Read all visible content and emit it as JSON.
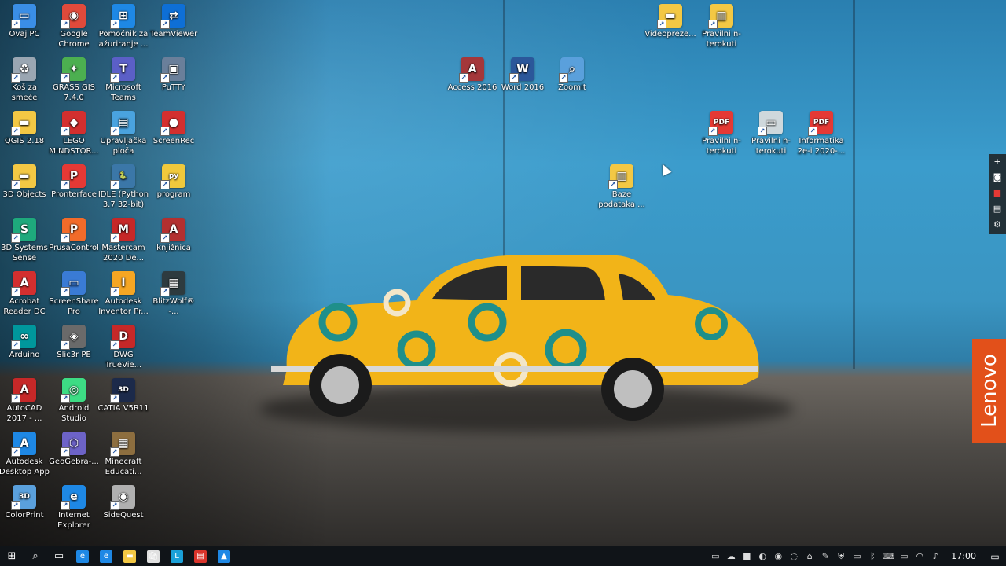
{
  "desktop": {
    "icons": [
      {
        "label": "Ovaj PC",
        "icon": "computer-icon",
        "color": "#3a8ee6",
        "glyph": "▭"
      },
      {
        "label": "Google Chrome",
        "icon": "chrome-icon",
        "color": "#e04a3b",
        "glyph": "◉"
      },
      {
        "label": "Pomoćnik za ažuriranje ...",
        "icon": "windows-update-icon",
        "color": "#1e88e5",
        "glyph": "⊞"
      },
      {
        "label": "TeamViewer",
        "icon": "teamviewer-icon",
        "color": "#0e6fd6",
        "glyph": "⇄"
      },
      {
        "label": "Koš za smeće",
        "icon": "recycle-bin-icon",
        "color": "#9aa6b2",
        "glyph": "♻"
      },
      {
        "label": "GRASS GIS 7.4.0",
        "icon": "grass-gis-icon",
        "color": "#4caf50",
        "glyph": "✦"
      },
      {
        "label": "Microsoft Teams",
        "icon": "teams-icon",
        "color": "#5b5fc7",
        "glyph": "T"
      },
      {
        "label": "PuTTY",
        "icon": "putty-icon",
        "color": "#6a7f9a",
        "glyph": "▣"
      },
      {
        "label": "QGIS 2.18",
        "icon": "qgis-folder-icon",
        "color": "#f3c844",
        "glyph": "▬"
      },
      {
        "label": "LEGO MINDSTOR...",
        "icon": "lego-mindstorms-icon",
        "color": "#d32f2f",
        "glyph": "◆"
      },
      {
        "label": "Upravljačka ploča",
        "icon": "control-panel-icon",
        "color": "#4aa3df",
        "glyph": "▤"
      },
      {
        "label": "ScreenRec",
        "icon": "screenrec-icon",
        "color": "#d32f2f",
        "glyph": "●"
      },
      {
        "label": "3D Objects",
        "icon": "3d-objects-folder-icon",
        "color": "#f3c844",
        "glyph": "▬"
      },
      {
        "label": "Pronterface",
        "icon": "pronterface-icon",
        "color": "#e53935",
        "glyph": "P"
      },
      {
        "label": "IDLE (Python 3.7 32-bit)",
        "icon": "python-idle-icon",
        "color": "#3b77a8",
        "glyph": "🐍"
      },
      {
        "label": "program",
        "icon": "python-file-icon",
        "color": "#f0c93c",
        "glyph": "py"
      },
      {
        "label": "3D Systems Sense",
        "icon": "3d-systems-sense-icon",
        "color": "#1ea97c",
        "glyph": "S"
      },
      {
        "label": "PrusaControl",
        "icon": "prusacontrol-icon",
        "color": "#f26b2a",
        "glyph": "P"
      },
      {
        "label": "Mastercam 2020 De...",
        "icon": "mastercam-icon",
        "color": "#c62828",
        "glyph": "M"
      },
      {
        "label": "knjižnica",
        "icon": "access-file-icon",
        "color": "#b33030",
        "glyph": "A"
      },
      {
        "label": "Acrobat Reader DC",
        "icon": "acrobat-icon",
        "color": "#d32f2f",
        "glyph": "A"
      },
      {
        "label": "ScreenShare Pro",
        "icon": "screenshare-icon",
        "color": "#3a7bd5",
        "glyph": "▭"
      },
      {
        "label": "Autodesk Inventor Pr...",
        "icon": "inventor-icon",
        "color": "#f5a623",
        "glyph": "I"
      },
      {
        "label": "BlitzWolf® -...",
        "icon": "blitzwolf-icon",
        "color": "#2e3b3f",
        "glyph": "▦"
      },
      {
        "label": "Arduino",
        "icon": "arduino-icon",
        "color": "#00979c",
        "glyph": "∞"
      },
      {
        "label": "Slic3r PE",
        "icon": "slic3r-icon",
        "color": "#6a6a6a",
        "glyph": "◈"
      },
      {
        "label": "DWG TrueVie...",
        "icon": "dwg-trueview-icon",
        "color": "#c62828",
        "glyph": "D"
      },
      {
        "label": "",
        "icon": "",
        "color": "",
        "glyph": ""
      },
      {
        "label": "AutoCAD 2017 - ...",
        "icon": "autocad-icon",
        "color": "#c62828",
        "glyph": "A"
      },
      {
        "label": "Android Studio",
        "icon": "android-studio-icon",
        "color": "#3ddc84",
        "glyph": "◎"
      },
      {
        "label": "CATIA V5R11",
        "icon": "catia-icon",
        "color": "#1c2a4a",
        "glyph": "3D"
      },
      {
        "label": "",
        "icon": "",
        "color": "",
        "glyph": ""
      },
      {
        "label": "Autodesk Desktop App",
        "icon": "autodesk-desktop-icon",
        "color": "#1e88e5",
        "glyph": "A"
      },
      {
        "label": "GeoGebra-...",
        "icon": "geogebra-icon",
        "color": "#6d63c7",
        "glyph": "⬡"
      },
      {
        "label": "Minecraft Educati...",
        "icon": "minecraft-icon",
        "color": "#8d6e3f",
        "glyph": "▦"
      },
      {
        "label": "",
        "icon": "",
        "color": "",
        "glyph": ""
      },
      {
        "label": "ColorPrint",
        "icon": "colorprint-icon",
        "color": "#5aa0dc",
        "glyph": "3D"
      },
      {
        "label": "Internet Explorer",
        "icon": "internet-explorer-icon",
        "color": "#1e88e5",
        "glyph": "e"
      },
      {
        "label": "SideQuest",
        "icon": "sidequest-icon",
        "color": "#b0b0b0",
        "glyph": "◉"
      }
    ],
    "floating_icons": [
      {
        "label": "Videopreze...",
        "icon": "folder-icon",
        "color": "#f3c844",
        "glyph": "▬"
      },
      {
        "label": "Pravilni n-terokuti",
        "icon": "zip-folder-icon",
        "color": "#f3c844",
        "glyph": "▥"
      },
      {
        "label": "Access 2016",
        "icon": "access-icon",
        "color": "#a4373a",
        "glyph": "A"
      },
      {
        "label": "Word 2016",
        "icon": "word-icon",
        "color": "#2b579a",
        "glyph": "W"
      },
      {
        "label": "ZoomIt",
        "icon": "zoomit-icon",
        "color": "#5aa0dc",
        "glyph": "⌕"
      },
      {
        "label": "Pravilni n-terokuti",
        "icon": "pdf-icon",
        "color": "#e53935",
        "glyph": "PDF"
      },
      {
        "label": "Pravilni n-terokuti",
        "icon": "image-file-icon",
        "color": "#cfd8dc",
        "glyph": "▭"
      },
      {
        "label": "Informatika 2e-i 2020-...",
        "icon": "pdf-icon",
        "color": "#e53935",
        "glyph": "PDF"
      },
      {
        "label": "Baze podataka ...",
        "icon": "zip-folder-icon",
        "color": "#f3c844",
        "glyph": "▥"
      }
    ],
    "brand_tab": "Lenovo"
  },
  "taskbar": {
    "start_glyph": "⊞",
    "search_glyph": "⌕",
    "taskview_glyph": "▭",
    "apps": [
      {
        "icon": "edge-icon",
        "color": "#1e88e5",
        "glyph": "e"
      },
      {
        "icon": "internet-explorer-icon",
        "color": "#1e88e5",
        "glyph": "e"
      },
      {
        "icon": "file-explorer-icon",
        "color": "#f3c844",
        "glyph": "▬"
      },
      {
        "icon": "store-icon",
        "color": "#e0e0e0",
        "glyph": "🛍"
      },
      {
        "icon": "l-app-icon",
        "color": "#1aa0d8",
        "glyph": "L"
      },
      {
        "icon": "red-app-icon",
        "color": "#d9342b",
        "glyph": "▤"
      },
      {
        "icon": "blue-app-icon",
        "color": "#1e88e5",
        "glyph": "▲"
      }
    ],
    "tray_icons": [
      "chat-icon",
      "onedrive-icon",
      "record-icon",
      "network-app-icon",
      "chrome-icon",
      "app-icon",
      "bitbucket-icon",
      "paint-icon",
      "shield-icon",
      "hdd-icon",
      "bluetooth-icon",
      "keyboard-icon",
      "battery-icon",
      "wifi-icon",
      "volume-icon"
    ],
    "clock": "17:00"
  },
  "colors": {
    "taskbar_bg": "#101418",
    "lenovo": "#e2501a",
    "car_body": "#f2b418",
    "car_pattern": "#1f8f8a"
  }
}
